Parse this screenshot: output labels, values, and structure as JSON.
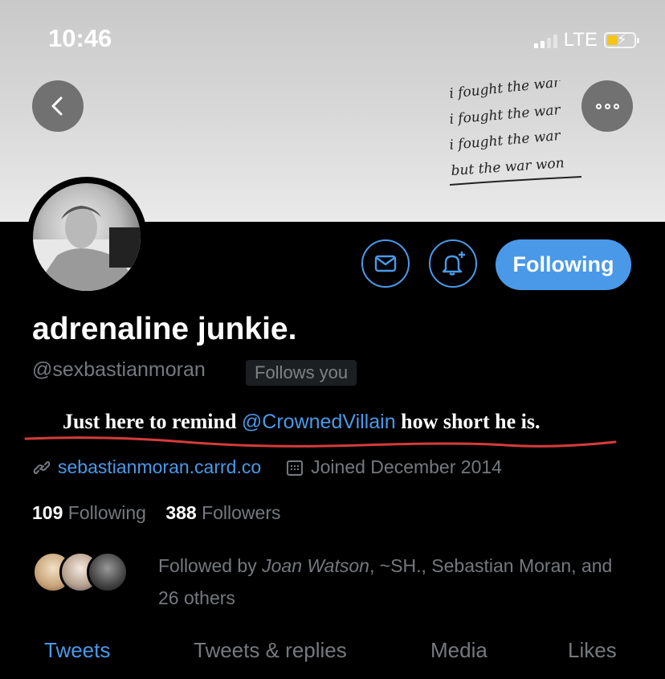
{
  "status_bar": {
    "time": "10:46",
    "network": "LTE"
  },
  "header": {
    "banner_text": [
      "i fought the war",
      "i fought the war",
      "i fought the war",
      "but the war won"
    ]
  },
  "profile": {
    "name": "adrenaline junkie.",
    "handle": "@sexbastianmoran",
    "follows_you": "Follows you",
    "bio_before": "Just here to remind ",
    "bio_mention": "@CrownedVillain",
    "bio_after": " how short he is.",
    "website": "sebastianmoran.carrd.co",
    "joined": "Joined December 2014",
    "following_count": "109",
    "following_label": "Following",
    "followers_count": "388",
    "followers_label": "Followers",
    "followed_by_prefix": "Followed by ",
    "followed_by_first": "Joan Watson",
    "followed_by_rest": ", ~SH., Sebastian Moran, and 26 others"
  },
  "actions": {
    "follow_label": "Following"
  },
  "tabs": [
    {
      "label": "Tweets",
      "active": true
    },
    {
      "label": "Tweets & replies",
      "active": false
    },
    {
      "label": "Media",
      "active": false
    },
    {
      "label": "Likes",
      "active": false
    }
  ],
  "colors": {
    "accent": "#4a99e9",
    "muted": "#75797e",
    "background": "#000000",
    "annotation_red": "#d63b3b"
  },
  "icons": [
    "back-arrow-icon",
    "more-dots-icon",
    "mail-icon",
    "bell-plus-icon",
    "link-icon",
    "calendar-icon",
    "signal-icon",
    "battery-icon"
  ]
}
